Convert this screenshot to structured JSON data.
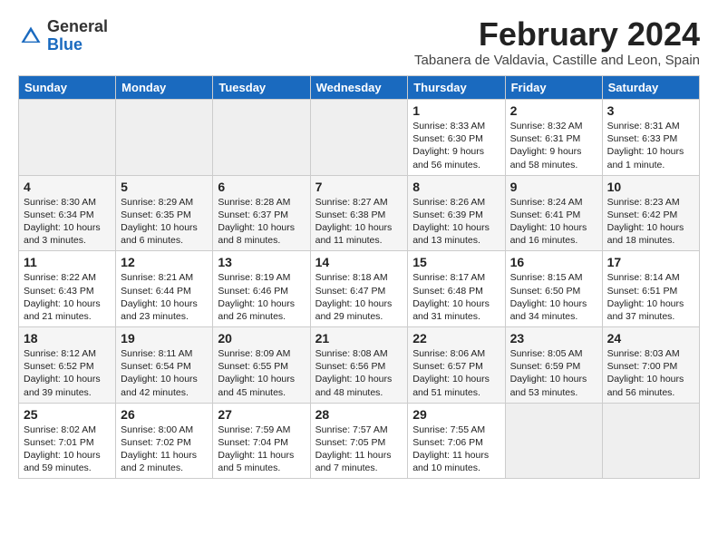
{
  "logo": {
    "general": "General",
    "blue": "Blue"
  },
  "title": "February 2024",
  "location": "Tabanera de Valdavia, Castille and Leon, Spain",
  "days_of_week": [
    "Sunday",
    "Monday",
    "Tuesday",
    "Wednesday",
    "Thursday",
    "Friday",
    "Saturday"
  ],
  "weeks": [
    [
      {
        "day": "",
        "content": ""
      },
      {
        "day": "",
        "content": ""
      },
      {
        "day": "",
        "content": ""
      },
      {
        "day": "",
        "content": ""
      },
      {
        "day": "1",
        "content": "Sunrise: 8:33 AM\nSunset: 6:30 PM\nDaylight: 9 hours and 56 minutes."
      },
      {
        "day": "2",
        "content": "Sunrise: 8:32 AM\nSunset: 6:31 PM\nDaylight: 9 hours and 58 minutes."
      },
      {
        "day": "3",
        "content": "Sunrise: 8:31 AM\nSunset: 6:33 PM\nDaylight: 10 hours and 1 minute."
      }
    ],
    [
      {
        "day": "4",
        "content": "Sunrise: 8:30 AM\nSunset: 6:34 PM\nDaylight: 10 hours and 3 minutes."
      },
      {
        "day": "5",
        "content": "Sunrise: 8:29 AM\nSunset: 6:35 PM\nDaylight: 10 hours and 6 minutes."
      },
      {
        "day": "6",
        "content": "Sunrise: 8:28 AM\nSunset: 6:37 PM\nDaylight: 10 hours and 8 minutes."
      },
      {
        "day": "7",
        "content": "Sunrise: 8:27 AM\nSunset: 6:38 PM\nDaylight: 10 hours and 11 minutes."
      },
      {
        "day": "8",
        "content": "Sunrise: 8:26 AM\nSunset: 6:39 PM\nDaylight: 10 hours and 13 minutes."
      },
      {
        "day": "9",
        "content": "Sunrise: 8:24 AM\nSunset: 6:41 PM\nDaylight: 10 hours and 16 minutes."
      },
      {
        "day": "10",
        "content": "Sunrise: 8:23 AM\nSunset: 6:42 PM\nDaylight: 10 hours and 18 minutes."
      }
    ],
    [
      {
        "day": "11",
        "content": "Sunrise: 8:22 AM\nSunset: 6:43 PM\nDaylight: 10 hours and 21 minutes."
      },
      {
        "day": "12",
        "content": "Sunrise: 8:21 AM\nSunset: 6:44 PM\nDaylight: 10 hours and 23 minutes."
      },
      {
        "day": "13",
        "content": "Sunrise: 8:19 AM\nSunset: 6:46 PM\nDaylight: 10 hours and 26 minutes."
      },
      {
        "day": "14",
        "content": "Sunrise: 8:18 AM\nSunset: 6:47 PM\nDaylight: 10 hours and 29 minutes."
      },
      {
        "day": "15",
        "content": "Sunrise: 8:17 AM\nSunset: 6:48 PM\nDaylight: 10 hours and 31 minutes."
      },
      {
        "day": "16",
        "content": "Sunrise: 8:15 AM\nSunset: 6:50 PM\nDaylight: 10 hours and 34 minutes."
      },
      {
        "day": "17",
        "content": "Sunrise: 8:14 AM\nSunset: 6:51 PM\nDaylight: 10 hours and 37 minutes."
      }
    ],
    [
      {
        "day": "18",
        "content": "Sunrise: 8:12 AM\nSunset: 6:52 PM\nDaylight: 10 hours and 39 minutes."
      },
      {
        "day": "19",
        "content": "Sunrise: 8:11 AM\nSunset: 6:54 PM\nDaylight: 10 hours and 42 minutes."
      },
      {
        "day": "20",
        "content": "Sunrise: 8:09 AM\nSunset: 6:55 PM\nDaylight: 10 hours and 45 minutes."
      },
      {
        "day": "21",
        "content": "Sunrise: 8:08 AM\nSunset: 6:56 PM\nDaylight: 10 hours and 48 minutes."
      },
      {
        "day": "22",
        "content": "Sunrise: 8:06 AM\nSunset: 6:57 PM\nDaylight: 10 hours and 51 minutes."
      },
      {
        "day": "23",
        "content": "Sunrise: 8:05 AM\nSunset: 6:59 PM\nDaylight: 10 hours and 53 minutes."
      },
      {
        "day": "24",
        "content": "Sunrise: 8:03 AM\nSunset: 7:00 PM\nDaylight: 10 hours and 56 minutes."
      }
    ],
    [
      {
        "day": "25",
        "content": "Sunrise: 8:02 AM\nSunset: 7:01 PM\nDaylight: 10 hours and 59 minutes."
      },
      {
        "day": "26",
        "content": "Sunrise: 8:00 AM\nSunset: 7:02 PM\nDaylight: 11 hours and 2 minutes."
      },
      {
        "day": "27",
        "content": "Sunrise: 7:59 AM\nSunset: 7:04 PM\nDaylight: 11 hours and 5 minutes."
      },
      {
        "day": "28",
        "content": "Sunrise: 7:57 AM\nSunset: 7:05 PM\nDaylight: 11 hours and 7 minutes."
      },
      {
        "day": "29",
        "content": "Sunrise: 7:55 AM\nSunset: 7:06 PM\nDaylight: 11 hours and 10 minutes."
      },
      {
        "day": "",
        "content": ""
      },
      {
        "day": "",
        "content": ""
      }
    ]
  ]
}
